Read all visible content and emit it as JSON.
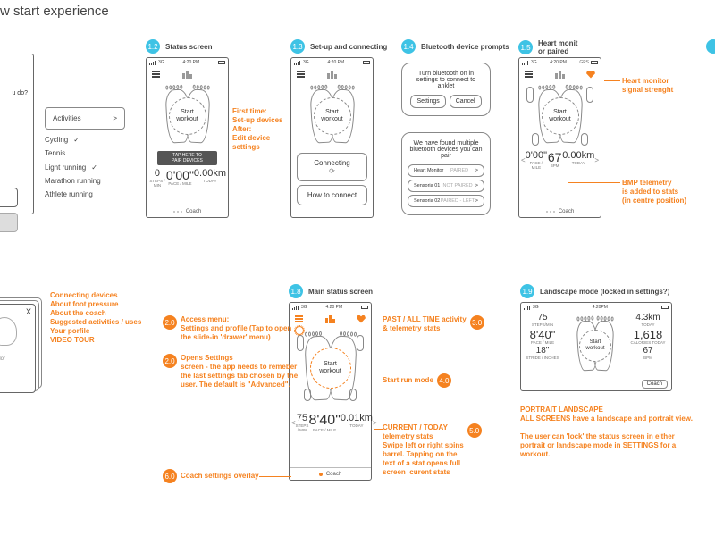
{
  "page_title": "w start experience",
  "topRow": {
    "s11": {
      "prompt": "u do?",
      "activities_label": "Activities",
      "items": [
        "Cycling",
        "Tennis",
        "Light running",
        "Marathon running",
        "Athlete running"
      ]
    },
    "s12": {
      "num": "1.2",
      "title": "Status screen",
      "statusbar": {
        "carrier": "3G",
        "time": "4:20 PM"
      },
      "start": "Start\nworkout",
      "pair_hint": "TAP HERE TO\nPAIR DEVICES",
      "stats": {
        "steps": "0",
        "steps_lbl": "STEPS / MIN",
        "pace": "0'00\"",
        "pace_lbl": "PACE / MILE",
        "dist": "0.00km",
        "dist_lbl": "TODAY"
      },
      "coach": "Coach",
      "anno": "First time:\nSet-up devices\nAfter:\nEdit device\nsettings"
    },
    "s13": {
      "num": "1.3",
      "title": "Set-up and connecting",
      "statusbar": {
        "carrier": "3G",
        "time": "4:20 PM"
      },
      "start": "Start\nworkout",
      "connecting": "Connecting",
      "how": "How to connect"
    },
    "s14": {
      "num": "1.4",
      "title": "Bluetooth device prompts",
      "prompt1": "Turn bluetooth on in settings to connect to anklet",
      "settings": "Settings",
      "cancel": "Cancel",
      "prompt2": "We have found multiple bluetooth devices you can pair",
      "rows": [
        {
          "name": "Heart Monitor",
          "state": "PAIRED"
        },
        {
          "name": "Sensoria 01",
          "state": "NOT PAIRED"
        },
        {
          "name": "Sensoria 02",
          "state": "PAIRED - LEFT"
        }
      ]
    },
    "s15": {
      "num": "1.5",
      "title": "Heart monit\nor paired",
      "statusbar": {
        "carrier": "3G",
        "time": "4:20 PM",
        "gps": "GPS"
      },
      "start": "Start\nworkout",
      "stats": {
        "pace": "0'00\"",
        "pace_lbl": "PACE / MILE",
        "bpm": "67",
        "bpm_lbl": "BPM",
        "dist": "0.00km",
        "dist_lbl": "TODAY"
      },
      "coach": "Coach",
      "anno_hr": "Heart monitor\nsignal strenght",
      "anno_bpm": "BMP telemetry\nis added to stats\n(in centre position)"
    }
  },
  "midRow": {
    "connecting_anno": "Connecting devices\nAbout foot pressure\nAbout the coach\nSuggested activities / uses\nYour porfile\nVIDEO TOUR",
    "card_text": "sit\nipsum dolor\nmps sit",
    "s18": {
      "num": "1.8",
      "title": "Main status screen",
      "statusbar": {
        "carrier": "3G",
        "time": "4:20 PM"
      },
      "start": "Start\nworkout",
      "stats": {
        "steps": "75",
        "steps_lbl": "STEPS / MIN",
        "pace": "8'40\"",
        "pace_lbl": "PACE / MILE",
        "dist": "0.01km",
        "dist_lbl": "TODAY"
      },
      "coach": "Coach",
      "annos": {
        "a20a": {
          "num": "2.0",
          "text": "Access menu:\nSettings and profile (Tap to open\nthe slide-in 'drawer' menu)"
        },
        "a20b": {
          "num": "2.0",
          "text": "Opens Settings\nscreen - the app needs to remeber\nthe last settings tab chosen by the\nuser. The default is \"Advanced\"."
        },
        "a30": {
          "num": "3.0",
          "text": "PAST / ALL TIME activity\n& telemetry stats"
        },
        "a40": {
          "num": "4.0",
          "text": "Start run mode"
        },
        "a50": {
          "num": "5.0",
          "text": "CURRENT / TODAY\ntelemetry stats\nSwipe left or right spins\nbarrel. Tapping on the\ntext of a stat opens full\nscreen  curent stats"
        },
        "a60": {
          "num": "6.0",
          "text": "Coach settings overlay"
        }
      }
    },
    "s19": {
      "num": "1.9",
      "title": "Landscape mode (locked in settings?)",
      "statusbar": {
        "carrier": "3G",
        "time": "4:20PM"
      },
      "start": "Start\nworkout",
      "left": {
        "steps": "75",
        "steps_lbl": "STEPS/MIN",
        "pace": "8'40\"",
        "pace_lbl": "PACE / MILE",
        "stride": "18\"",
        "stride_lbl": "STRIDE / INCHES"
      },
      "right": {
        "dist": "4.3km",
        "dist_lbl": "TODAY",
        "cal": "1,618",
        "cal_lbl": "CALORIES TODAY",
        "bpm": "67",
        "bpm_lbl": "BPM"
      },
      "coach": "Coach",
      "anno": "PORTRAIT LANDSCAPE\nALL SCREENS have a landscape and portrait view.\n\nThe user can 'lock' the status screen in either portrait or landscape mode in SETTINGS for a workout."
    }
  }
}
